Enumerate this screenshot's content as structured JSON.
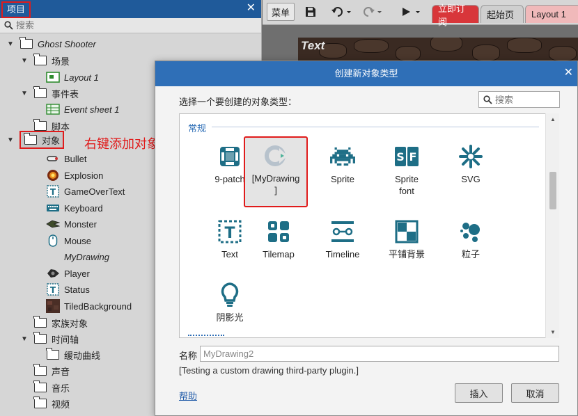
{
  "project": {
    "title": "项目",
    "search_placeholder": "搜索",
    "root": "Ghost Shooter",
    "scenes_folder": "场景",
    "layout_item": "Layout 1",
    "event_sheets_folder": "事件表",
    "event_sheet_item": "Event sheet 1",
    "scripts_folder": "脚本",
    "objects_folder": "对象",
    "objects": [
      "Bullet",
      "Explosion",
      "GameOverText",
      "Keyboard",
      "Monster",
      "Mouse",
      "MyDrawing",
      "Player",
      "Status",
      "TiledBackground"
    ],
    "families_folder": "家族对象",
    "timelines_folder": "时间轴",
    "easing_folder": "缓动曲线",
    "sounds_folder": "声音",
    "music_folder": "音乐",
    "videos_folder": "视频"
  },
  "annotation": "右键添加对象",
  "toolbar": {
    "menu_label": "菜单",
    "tabs": [
      "立即订阅",
      "起始页",
      "Layout 1"
    ]
  },
  "canvas_text": "Text",
  "dialog": {
    "title": "创建新对象类型",
    "prompt": "选择一个要创建的对象类型：",
    "search_placeholder": "搜索",
    "category": "常规",
    "types": [
      {
        "label": "9-patch",
        "icon": "nine-patch-icon"
      },
      {
        "label": "[MyDrawing\n]",
        "icon": "mydrawing-icon"
      },
      {
        "label": "Sprite",
        "icon": "sprite-icon"
      },
      {
        "label": "Sprite\nfont",
        "icon": "sprite-font-icon"
      },
      {
        "label": "SVG",
        "icon": "svg-icon"
      },
      {
        "label": "Text",
        "icon": "text-icon"
      },
      {
        "label": "Tilemap",
        "icon": "tilemap-icon"
      },
      {
        "label": "Timeline",
        "icon": "timeline-icon"
      },
      {
        "label": "平铺背景",
        "icon": "tiled-background-icon"
      },
      {
        "label": "粒子",
        "icon": "particles-icon"
      },
      {
        "label": "阴影光",
        "icon": "shadow-light-icon"
      }
    ],
    "name_label": "名称",
    "name_value": "MyDrawing2",
    "description": "[Testing a custom drawing third-party plugin.]",
    "help_label": "帮助",
    "insert_label": "插入",
    "cancel_label": "取消"
  },
  "colors": {
    "accent": "#2f6fb7",
    "highlight_red": "#e01b1b",
    "icon_teal": "#1e6e86"
  }
}
